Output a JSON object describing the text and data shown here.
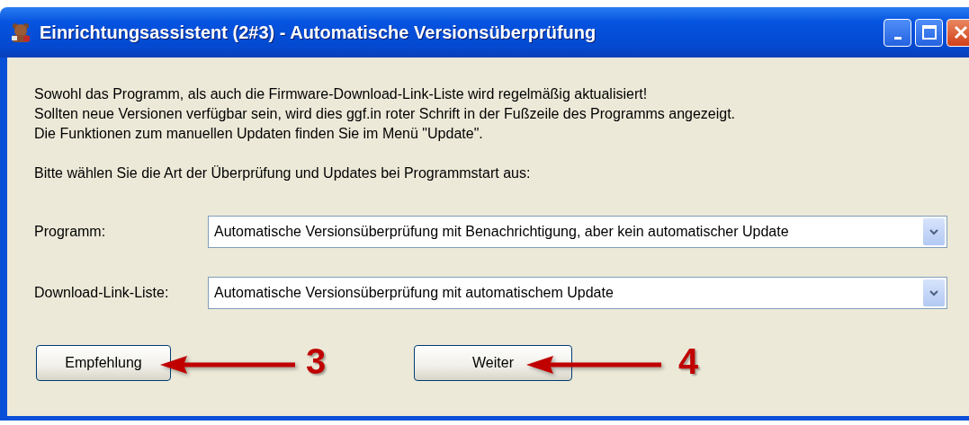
{
  "window": {
    "title": "Einrichtungsassistent (2#3) - Automatische Versionsüberprüfung"
  },
  "intro": [
    "Sowohl das Programm, als auch die Firmware-Download-Link-Liste wird regelmäßig aktualisiert!",
    "Sollten neue Versionen verfügbar sein, wird dies ggf.in roter Schrift in der Fußzeile des Programms angezeigt.",
    "Die Funktionen zum manuellen Updaten finden Sie im Menü \"Update\"."
  ],
  "prompt": "Bitte wählen Sie die Art der Überprüfung und Updates bei Programmstart aus:",
  "settings": [
    {
      "label": "Programm:",
      "value": "Automatische Versionsüberprüfung mit Benachrichtigung, aber kein automatischer Update"
    },
    {
      "label": "Download-Link-Liste:",
      "value": "Automatische Versionsüberprüfung mit automatischem Update"
    }
  ],
  "buttons": [
    {
      "label": "Empfehlung",
      "annotation": "3"
    },
    {
      "label": "Weiter",
      "annotation": "4"
    }
  ]
}
